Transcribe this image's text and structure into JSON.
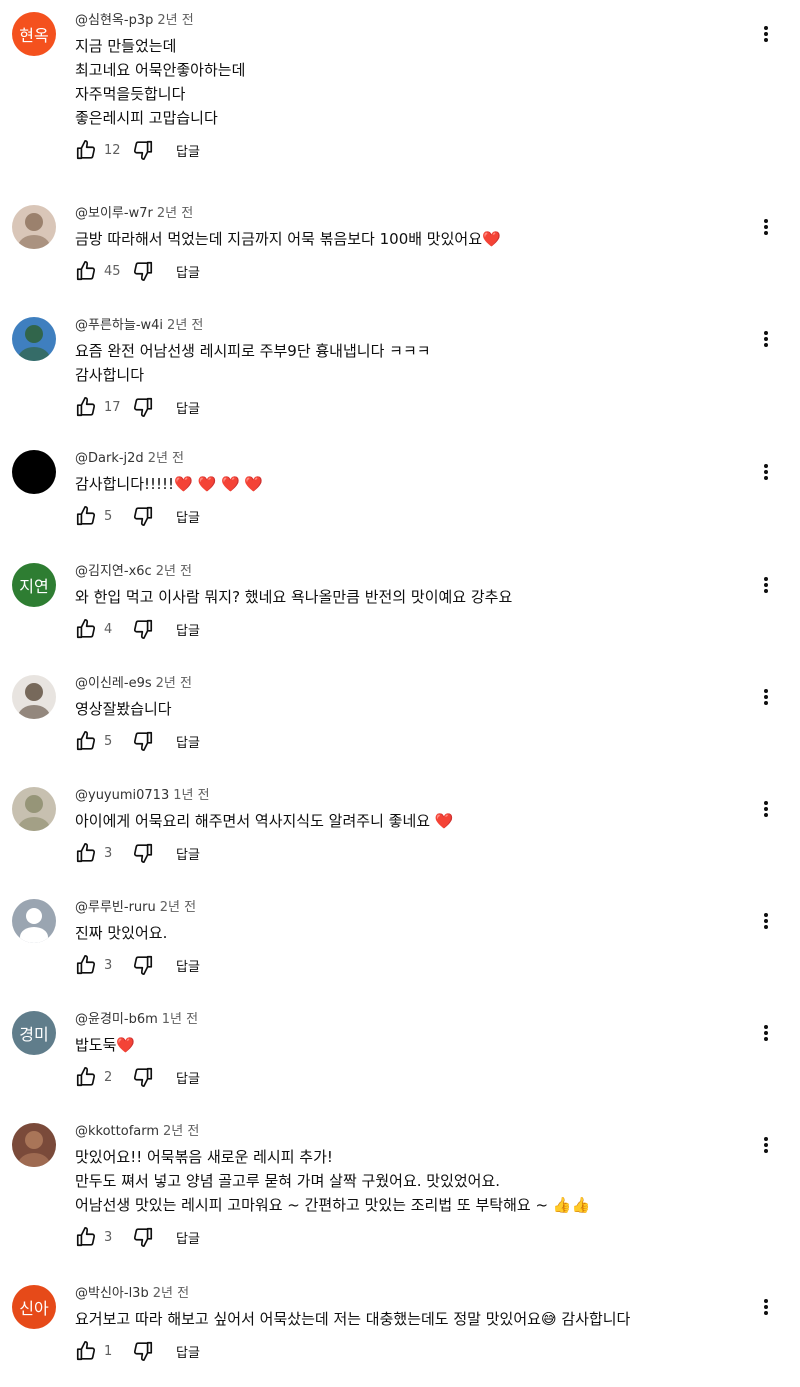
{
  "comments": [
    {
      "avatar": {
        "type": "initials",
        "text": "현옥",
        "color": "#f4511e"
      },
      "author": "@심현옥-p3p",
      "time": "2년 전",
      "lines": [
        "지금 만들었는데",
        "최고네요 어묵안좋아하는데",
        "자주먹을듯합니다",
        "좋은레시피 고맙습니다"
      ],
      "likes": "12",
      "reply_label": "답글"
    },
    {
      "avatar": {
        "type": "photo",
        "color": "#d9c6b8",
        "accent": "#8b6f5a"
      },
      "author": "@보이루-w7r",
      "time": "2년 전",
      "lines": [
        "금방  따라해서 먹었는데 지금까지 어묵 볶음보다 100배 맛있어요❤️"
      ],
      "likes": "45",
      "reply_label": "답글"
    },
    {
      "avatar": {
        "type": "photo",
        "color": "#3f7fbf",
        "accent": "#2e5f2e"
      },
      "author": "@푸른하늘-w4i",
      "time": "2년 전",
      "lines": [
        "요즘 완전 어남선생 레시피로 주부9단 흉내냅니다 ㅋㅋㅋ",
        "감사합니다"
      ],
      "likes": "17",
      "reply_label": "답글"
    },
    {
      "avatar": {
        "type": "solid",
        "color": "#000000"
      },
      "author": "@Dark-j2d",
      "time": "2년 전",
      "lines": [
        "감사합니다!!!!!❤️ ❤️ ❤️ ❤️"
      ],
      "likes": "5",
      "reply_label": "답글"
    },
    {
      "avatar": {
        "type": "initials",
        "text": "지연",
        "color": "#2e7d32"
      },
      "author": "@김지연-x6c",
      "time": "2년 전",
      "lines": [
        "와 한입 먹고 이사람 뭐지? 했네요 욕나올만큼 반전의 맛이예요 강추요"
      ],
      "likes": "4",
      "reply_label": "답글"
    },
    {
      "avatar": {
        "type": "photo",
        "color": "#e8e4e0",
        "accent": "#5a4a3a"
      },
      "author": "@이신레-e9s",
      "time": "2년 전",
      "lines": [
        "영상잘봤습니다"
      ],
      "likes": "5",
      "reply_label": "답글"
    },
    {
      "avatar": {
        "type": "photo",
        "color": "#c7c0b0",
        "accent": "#8a8a6a"
      },
      "author": "@yuyumi0713",
      "time": "1년 전",
      "lines": [
        "아이에게 어묵요리 해주면서 역사지식도 알려주니 좋네요 ❤️"
      ],
      "likes": "3",
      "reply_label": "답글"
    },
    {
      "avatar": {
        "type": "default",
        "color": "#9aa5b1"
      },
      "author": "@루루빈-ruru",
      "time": "2년 전",
      "lines": [
        "진짜 맛있어요."
      ],
      "likes": "3",
      "reply_label": "답글"
    },
    {
      "avatar": {
        "type": "initials",
        "text": "경미",
        "color": "#607d8b"
      },
      "author": "@윤경미-b6m",
      "time": "1년 전",
      "lines": [
        "밥도둑❤️"
      ],
      "likes": "2",
      "reply_label": "답글"
    },
    {
      "avatar": {
        "type": "photo",
        "color": "#7a4a3a",
        "accent": "#b58060"
      },
      "author": "@kkottofarm",
      "time": "2년 전",
      "lines": [
        "맛있어요!! 어묵볶음 새로운 레시피 추가!",
        "만두도 쪄서 넣고 양념 골고루 묻혀 가며 살짝 구웠어요. 맛있었어요.",
        "어남선생 맛있는 레시피 고마워요 ~ 간편하고 맛있는 조리법 또 부탁해요 ~ 👍👍"
      ],
      "likes": "3",
      "reply_label": "답글"
    },
    {
      "avatar": {
        "type": "initials",
        "text": "신아",
        "color": "#e64a19"
      },
      "author": "@박신아-l3b",
      "time": "2년 전",
      "lines": [
        "요거보고 따라 해보고 싶어서 어묵샀는데 저는 대충했는데도 정말 맛있어요😅  감사합니다"
      ],
      "likes": "1",
      "reply_label": "답글"
    }
  ]
}
